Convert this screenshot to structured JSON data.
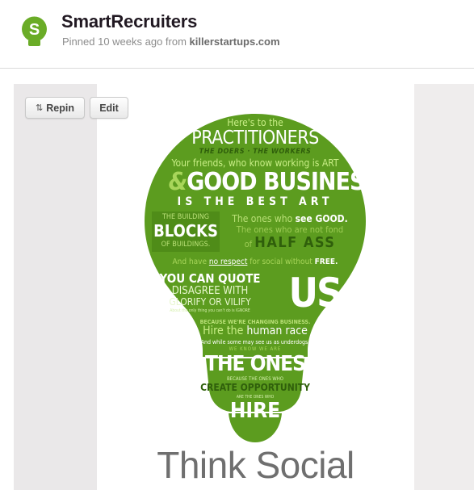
{
  "header": {
    "board_title": "SmartRecruiters",
    "avatar_letter": "S",
    "pinned_prefix": "Pinned 10 weeks ago from ",
    "source_domain": "killerstartups.com"
  },
  "actions": {
    "repin_label": "Repin",
    "edit_label": "Edit"
  },
  "poster": {
    "line1": "Here's to the",
    "line2": "PRACTITIONERS",
    "line3": "THE DOERS · THE WORKERS",
    "line4": "Your friends, who know working is ART",
    "line5a": "&",
    "line5b": "GOOD BUSINES",
    "line6": "IS THE BEST ART",
    "line7a": "THE BUILDING",
    "line7b": "The ones who ",
    "line7c": "see GOOD.",
    "line8a": "BLOCKS",
    "line8b": "The ones who are not fond",
    "line9a": "OF BUILDINGS.",
    "line9b": "of ",
    "line9c": "HALF ASS",
    "line10a": "And have ",
    "line10b": "no respect",
    "line10c": " for social without ",
    "line10d": "FREE.",
    "line11": "YOU CAN QUOTE",
    "line12": "DISAGREE WITH",
    "line13": "GLORIFY OR VILIFY",
    "line14": "About the only thing you can't do is IGNORE",
    "us": "US",
    "line15": "BECAUSE WE'RE CHANGING BUSINESS.",
    "line16a": "Hire the ",
    "line16b": "human race",
    "line17": "And while some may see us as underdogs,",
    "line18": "WE KNOW WE ARE",
    "line19": "THE ONES",
    "line20": "BECAUSE THE ONES WHO",
    "line21": "CREATE OPPORTUNITY",
    "line22": "ARE THE ONES WHO",
    "line23": "HIRE",
    "footer": "Think Social"
  },
  "colors": {
    "brand_green": "#5a9a1e",
    "dark_green": "#3e7812",
    "light_green": "#a8d65a"
  }
}
